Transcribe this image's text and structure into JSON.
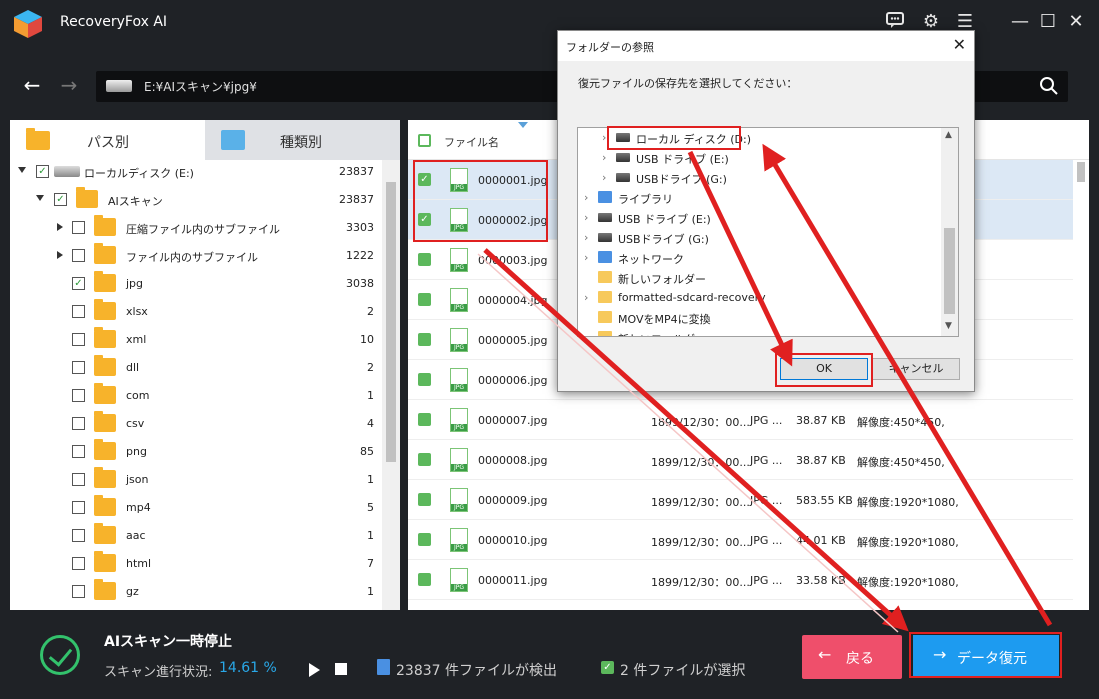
{
  "app": {
    "title": "RecoveryFox AI"
  },
  "path": {
    "value": "E:¥AIスキャン¥jpg¥"
  },
  "left_tabs": [
    {
      "label": "パス別"
    },
    {
      "label": "種類別"
    }
  ],
  "tree": [
    {
      "label": "ローカルディスク (E:)",
      "count": "23837",
      "level": 0,
      "expand": "down",
      "checked": true,
      "icon": "drive-icon"
    },
    {
      "label": "AIスキャン",
      "count": "23837",
      "level": 1,
      "expand": "down",
      "checked": true,
      "icon": "scan-folder-icon"
    },
    {
      "label": "圧縮ファイル内のサブファイル",
      "count": "3303",
      "level": 2,
      "expand": "right",
      "checked": false,
      "icon": "folder-icon"
    },
    {
      "label": "ファイル内のサブファイル",
      "count": "1222",
      "level": 2,
      "expand": "right",
      "checked": false,
      "icon": "folder-icon"
    },
    {
      "label": "jpg",
      "count": "3038",
      "level": 2,
      "expand": "",
      "checked": true,
      "icon": "folder-icon"
    },
    {
      "label": "xlsx",
      "count": "2",
      "level": 2,
      "expand": "",
      "checked": false,
      "icon": "folder-icon"
    },
    {
      "label": "xml",
      "count": "10",
      "level": 2,
      "expand": "",
      "checked": false,
      "icon": "folder-icon"
    },
    {
      "label": "dll",
      "count": "2",
      "level": 2,
      "expand": "",
      "checked": false,
      "icon": "folder-icon"
    },
    {
      "label": "com",
      "count": "1",
      "level": 2,
      "expand": "",
      "checked": false,
      "icon": "folder-icon"
    },
    {
      "label": "csv",
      "count": "4",
      "level": 2,
      "expand": "",
      "checked": false,
      "icon": "folder-icon"
    },
    {
      "label": "png",
      "count": "85",
      "level": 2,
      "expand": "",
      "checked": false,
      "icon": "folder-icon"
    },
    {
      "label": "json",
      "count": "1",
      "level": 2,
      "expand": "",
      "checked": false,
      "icon": "folder-icon"
    },
    {
      "label": "mp4",
      "count": "5",
      "level": 2,
      "expand": "",
      "checked": false,
      "icon": "folder-icon"
    },
    {
      "label": "aac",
      "count": "1",
      "level": 2,
      "expand": "",
      "checked": false,
      "icon": "folder-icon"
    },
    {
      "label": "html",
      "count": "7",
      "level": 2,
      "expand": "",
      "checked": false,
      "icon": "folder-icon"
    },
    {
      "label": "gz",
      "count": "1",
      "level": 2,
      "expand": "",
      "checked": false,
      "icon": "folder-icon"
    }
  ],
  "file_list": {
    "header_name": "ファイル名",
    "rows": [
      {
        "name": "0000001.jpg",
        "date": "",
        "type": "",
        "size": "",
        "res": "",
        "selected": true
      },
      {
        "name": "0000002.jpg",
        "date": "",
        "type": "",
        "size": "",
        "res": "",
        "selected": true
      },
      {
        "name": "0000003.jpg",
        "date": "",
        "type": "",
        "size": "",
        "res": "",
        "selected": false
      },
      {
        "name": "0000004.jpg",
        "date": "",
        "type": "",
        "size": "",
        "res": "",
        "selected": false
      },
      {
        "name": "0000005.jpg",
        "date": "",
        "type": "",
        "size": "",
        "res": "",
        "selected": false
      },
      {
        "name": "0000006.jpg",
        "date": "",
        "type": "",
        "size": "",
        "res": "",
        "selected": false
      },
      {
        "name": "0000007.jpg",
        "date": "1899/12/30：00...",
        "type": "JPG ...",
        "size": "38.87 KB",
        "res": "解像度:450*450,",
        "selected": false
      },
      {
        "name": "0000008.jpg",
        "date": "1899/12/30：00...",
        "type": "JPG ...",
        "size": "38.87 KB",
        "res": "解像度:450*450,",
        "selected": false
      },
      {
        "name": "0000009.jpg",
        "date": "1899/12/30：00...",
        "type": "JPG ...",
        "size": "583.55 KB",
        "res": "解像度:1920*1080,",
        "selected": false
      },
      {
        "name": "0000010.jpg",
        "date": "1899/12/30：00...",
        "type": "JPG ...",
        "size": "44.01 KB",
        "res": "解像度:1920*1080,",
        "selected": false
      },
      {
        "name": "0000011.jpg",
        "date": "1899/12/30：00...",
        "type": "JPG ...",
        "size": "33.58 KB",
        "res": "解像度:1920*1080,",
        "selected": false
      }
    ]
  },
  "status": {
    "title": "AIスキャン一時停止",
    "progress_label": "スキャン進行状況:",
    "progress_value": "14.61 %",
    "found": "23837 件ファイルが検出",
    "selected": "2 件ファイルが選択"
  },
  "buttons": {
    "back": "戻る",
    "recover": "データ復元"
  },
  "dialog": {
    "title": "フォルダーの参照",
    "message": "復元ファイルの保存先を選択してください：",
    "items": [
      {
        "label": "ローカル ディスク (D:)",
        "icon": "drive-icon",
        "indent": 1,
        "chevron": true
      },
      {
        "label": "USB ドライブ (E:)",
        "icon": "drive-icon",
        "indent": 1,
        "chevron": true
      },
      {
        "label": "USBドライブ (G:)",
        "icon": "drive-icon",
        "indent": 1,
        "chevron": true
      },
      {
        "label": "ライブラリ",
        "icon": "library-icon",
        "indent": 0,
        "chevron": true
      },
      {
        "label": "USB ドライブ (E:)",
        "icon": "drive-icon",
        "indent": 0,
        "chevron": true
      },
      {
        "label": "USBドライブ (G:)",
        "icon": "drive-icon",
        "indent": 0,
        "chevron": true
      },
      {
        "label": "ネットワーク",
        "icon": "network-icon",
        "indent": 0,
        "chevron": true
      },
      {
        "label": "新しいフォルダー",
        "icon": "folder-icon",
        "indent": 0,
        "chevron": false
      },
      {
        "label": "formatted-sdcard-recovery",
        "icon": "folder-icon",
        "indent": 0,
        "chevron": true
      },
      {
        "label": "MOVをMP4に変換",
        "icon": "folder-icon",
        "indent": 0,
        "chevron": false
      },
      {
        "label": "新しいフォルダー",
        "icon": "folder-icon",
        "indent": 0,
        "chevron": false
      }
    ],
    "ok": "OK",
    "cancel": "キャンセル"
  },
  "colors": {
    "accent": "#1d9bf0",
    "back_button": "#ef4f6b",
    "annotation_red": "#e02020",
    "success": "#33c26c"
  }
}
